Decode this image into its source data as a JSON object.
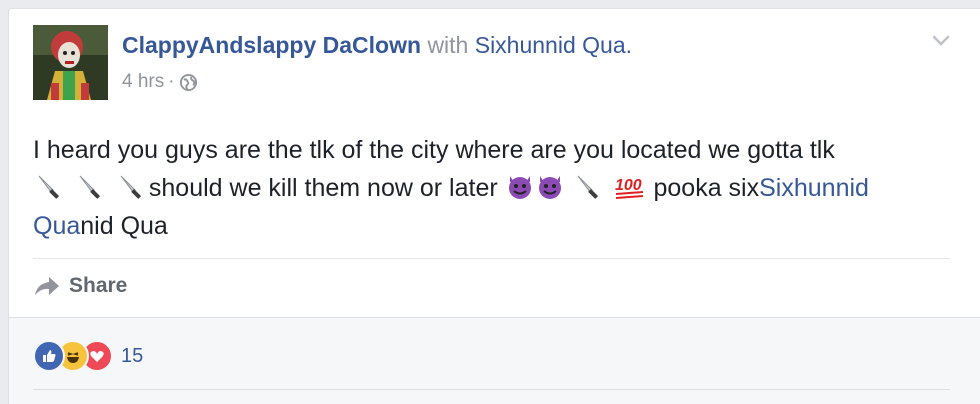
{
  "post": {
    "author": "ClappyAndslappy DaClown",
    "with_text": "with",
    "tagged": "Sixhunnid Qua.",
    "time": "4 hrs",
    "dot": "·",
    "text_part1": "I heard you guys are the tlk of the city where are you located we gotta tlk",
    "text_part2": "should we kill them now or later",
    "text_part3": "pooka six",
    "mention_a": "Sixhunnid",
    "mention_b": "Qua",
    "text_part4": "nid Qua"
  },
  "actions": {
    "share_label": "Share"
  },
  "reactions": {
    "count": "15",
    "icons": [
      "like-icon",
      "haha-icon",
      "love-icon"
    ]
  },
  "colors": {
    "link": "#365899",
    "like": "#4267b2",
    "haha": "#f7c33c",
    "love": "#ed4956"
  }
}
